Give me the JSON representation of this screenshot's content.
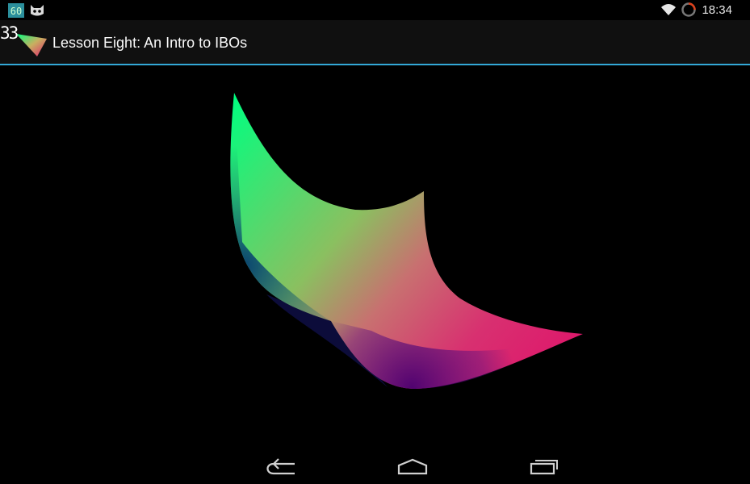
{
  "status_bar": {
    "time": "18:34",
    "left_icons": [
      "fps-counter-icon",
      "android-cat-icon"
    ],
    "right_icons": [
      "wifi-icon",
      "battery-ring-icon"
    ]
  },
  "action_bar": {
    "title": "Lesson Eight: An Intro to IBOs",
    "overlay_text": "33",
    "accent_color": "#33a8d6"
  },
  "gl_surface": {
    "description_icon": "height-map-mesh",
    "colors": [
      "#00ff80",
      "#c8c060",
      "#e0206e",
      "#3a007a",
      "#0a0a3a"
    ]
  },
  "nav_bar": {
    "buttons": [
      "back-icon",
      "home-icon",
      "recent-apps-icon"
    ]
  }
}
